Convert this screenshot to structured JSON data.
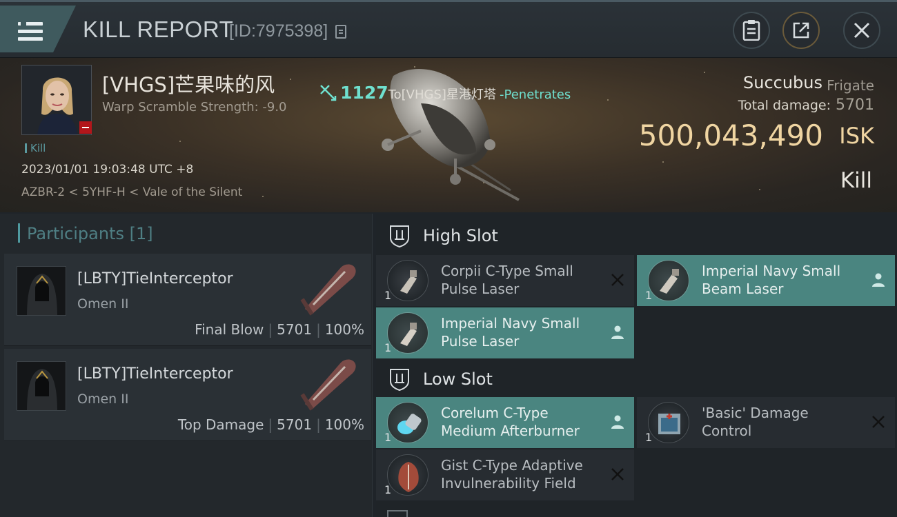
{
  "header": {
    "title": "KILL REPORT",
    "report_id": "[ID:7975398]"
  },
  "victim": {
    "name": "[VHGS]芒果味的风",
    "warp_scramble": "Warp Scramble Strength: -9.0",
    "kill_tag": "Kill",
    "datetime": "2023/01/01 19:03:48 UTC +8",
    "location": "AZBR-2 < 5YHF-H < Vale of the Silent"
  },
  "damage_event": {
    "amount": "1127",
    "target": "To[VHGS]星港灯塔",
    "effect": "-Penetrates"
  },
  "ship": {
    "name": "Succubus",
    "class": "Frigate",
    "total_damage_label": "Total damage:",
    "total_damage_value": "5701",
    "isk_value": "500,043,490",
    "isk_unit": "ISK",
    "result": "Kill"
  },
  "participants": {
    "header": "Participants [1]",
    "rows": [
      {
        "name": "[LBTY]TieInterceptor",
        "ship": "Omen II",
        "role": "Final Blow",
        "damage": "5701",
        "percent": "100%"
      },
      {
        "name": "[LBTY]TieInterceptor",
        "ship": "Omen II",
        "role": "Top Damage",
        "damage": "5701",
        "percent": "100%"
      }
    ]
  },
  "slots": {
    "high": {
      "title": "High Slot",
      "modules": [
        {
          "line1": "Corpii C-Type Small",
          "line2": "Pulse Laser",
          "qty": "1",
          "status": "destroyed"
        },
        {
          "line1": "Imperial Navy Small",
          "line2": "Beam Laser",
          "qty": "1",
          "status": "dropped"
        },
        {
          "line1": "Imperial Navy Small",
          "line2": "Pulse Laser",
          "qty": "1",
          "status": "dropped"
        }
      ]
    },
    "low": {
      "title": "Low Slot",
      "modules": [
        {
          "line1": "Corelum C-Type",
          "line2": "Medium Afterburner",
          "qty": "1",
          "status": "dropped"
        },
        {
          "line1": "'Basic' Damage",
          "line2": "Control",
          "qty": "1",
          "status": "destroyed"
        },
        {
          "line1": "Gist C-Type Adaptive",
          "line2": "Invulnerability Field",
          "qty": "1",
          "status": "destroyed"
        }
      ]
    }
  },
  "colors": {
    "accent_teal": "#6fe0cf",
    "isk_gold": "#f0d5a2",
    "dropped_bg": "#4a8580",
    "destroyed_bg": "#272c31",
    "danger_red": "#b3161b"
  },
  "icons": [
    "menu-icon",
    "copy-icon",
    "clipboard-icon",
    "share-icon",
    "close-icon",
    "shield-slot-icon",
    "person-icon",
    "x-mark-icon",
    "warp-disruptor-icon"
  ]
}
